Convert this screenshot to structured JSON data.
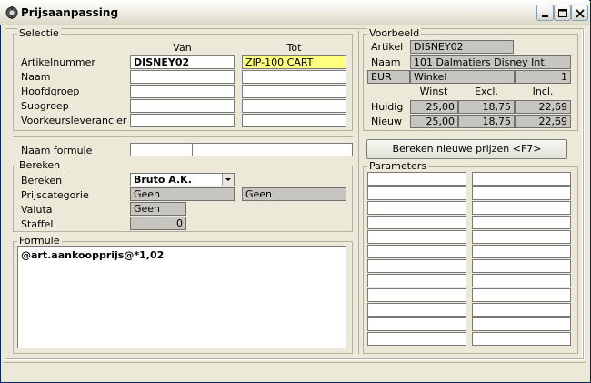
{
  "window": {
    "title": "Prijsaanpassing"
  },
  "selectie": {
    "legend": "Selectie",
    "col_van": "Van",
    "col_tot": "Tot",
    "rows": [
      {
        "label": "Artikelnummer",
        "van": "DISNEY02",
        "tot": "ZIP-100 CART"
      },
      {
        "label": "Naam",
        "van": "",
        "tot": ""
      },
      {
        "label": "Hoofdgroep",
        "van": "",
        "tot": ""
      },
      {
        "label": "Subgroep",
        "van": "",
        "tot": ""
      },
      {
        "label": "Voorkeursleverancier",
        "van": "",
        "tot": ""
      }
    ]
  },
  "voorbeeld": {
    "legend": "Voorbeeld",
    "artikel_label": "Artikel",
    "artikel_value": "DISNEY02",
    "naam_label": "Naam",
    "naam_value": "101 Dalmatiers Disney Int.",
    "currency": "EUR",
    "store": "Winkel",
    "store_qty": "1",
    "col_winst": "Winst",
    "col_excl": "Excl.",
    "col_incl": "Incl.",
    "huidig": {
      "label": "Huidig",
      "winst": "25,00",
      "excl": "18,75",
      "incl": "22,69"
    },
    "nieuw": {
      "label": "Nieuw",
      "winst": "25,00",
      "excl": "18,75",
      "incl": "22,69"
    }
  },
  "naam_formule": {
    "label": "Naam formule",
    "value": ""
  },
  "bereken": {
    "legend": "Bereken",
    "bereken_label": "Bereken",
    "bereken_value": "Bruto A.K.",
    "prijscategorie_label": "Prijscategorie",
    "prijscategorie_van": "Geen",
    "prijscategorie_tot": "Geen",
    "valuta_label": "Valuta",
    "valuta_value": "Geen",
    "staffel_label": "Staffel",
    "staffel_value": "0"
  },
  "formule": {
    "legend": "Formule",
    "text": "@art.aankoopprijs@*1,02"
  },
  "actions": {
    "calc_button": "Bereken nieuwe prijzen <F7>"
  },
  "parameters": {
    "legend": "Parameters",
    "rows": 12
  }
}
